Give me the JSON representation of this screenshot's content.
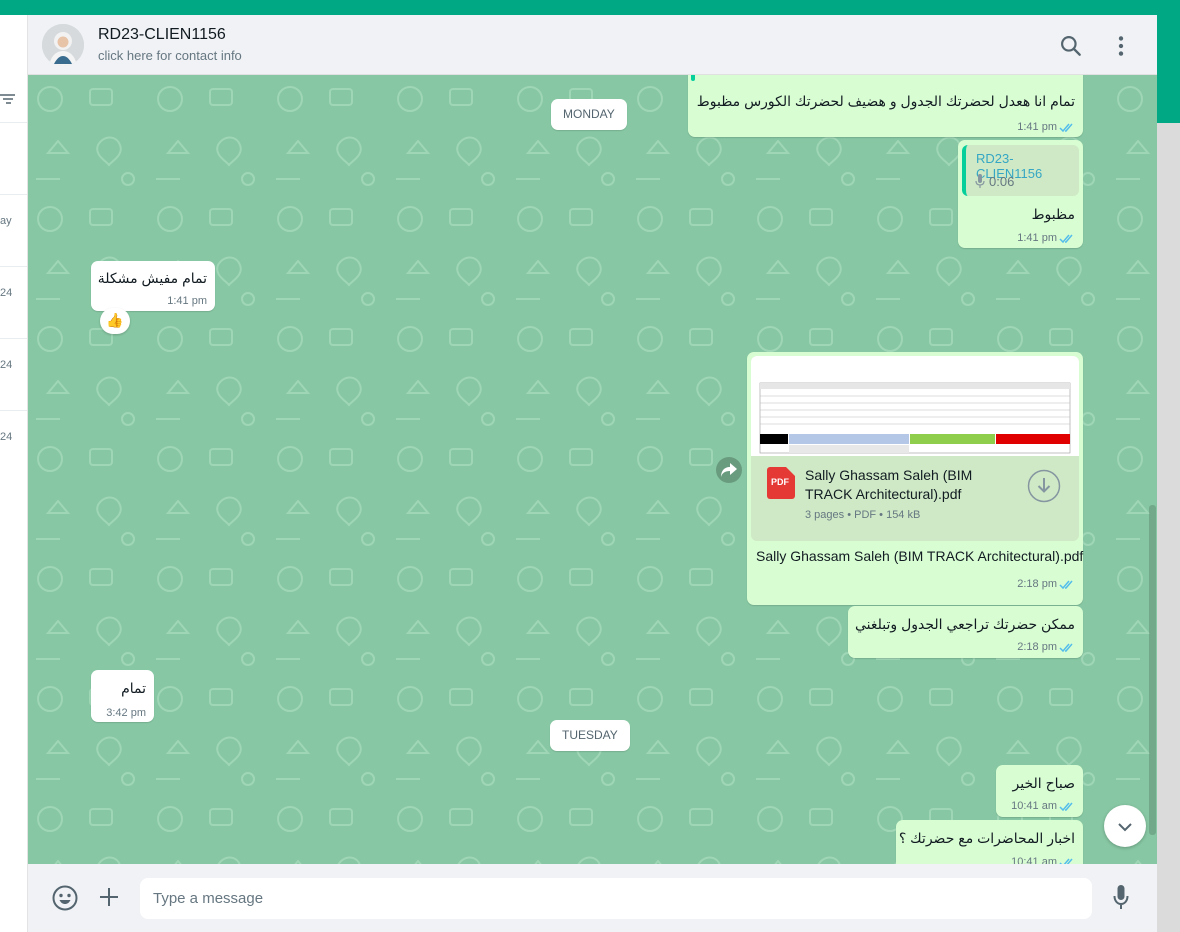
{
  "header": {
    "contact_name": "RD23-CLIEN1156",
    "contact_subtitle": "click here for contact info"
  },
  "sidebar_fragments": [
    "ay",
    "24",
    "24",
    "24"
  ],
  "dates": {
    "monday": "MONDAY",
    "tuesday": "TUESDAY"
  },
  "messages": {
    "m1": {
      "text": "تمام انا هعدل لحضرتك الجدول و هضيف لحضرتك الكورس مظبوط",
      "time": "1:41 pm"
    },
    "m2": {
      "quote_author": "RD23-CLIEN1156",
      "quote_duration": "0:06",
      "text": "مظبوط",
      "time": "1:41 pm"
    },
    "m3": {
      "text": "تمام مفيش مشكلة",
      "time": "1:41 pm",
      "reaction": "👍"
    },
    "m4": {
      "file_name": "Sally Ghassam Saleh (BIM TRACK Architectural).pdf",
      "file_type_badge": "PDF",
      "file_meta": "3 pages • PDF • 154 kB",
      "caption": "Sally Ghassam Saleh (BIM TRACK Architectural).pdf",
      "time": "2:18 pm"
    },
    "m5": {
      "text": "ممكن حضرتك تراجعي الجدول وتبلغني",
      "time": "2:18 pm"
    },
    "m6": {
      "text": "تمام",
      "time": "3:42 pm"
    },
    "m7": {
      "text": "صباح الخير",
      "time": "10:41 am"
    },
    "m8": {
      "text": "اخبار المحاضرات مع حضرتك ؟",
      "time": "10:41 am"
    }
  },
  "composer": {
    "placeholder": "Type a message"
  },
  "colors": {
    "accent": "#00a884",
    "outgoing_bubble": "#d9fdd3",
    "incoming_bubble": "#ffffff",
    "chat_background": "#87c7a3",
    "read_tick": "#53bdeb"
  },
  "icons": [
    "search-icon",
    "menu-icon",
    "emoji-icon",
    "plus-icon",
    "mic-icon",
    "forward-icon",
    "download-icon",
    "chevron-down-icon",
    "filter-icon",
    "pdf-icon"
  ]
}
